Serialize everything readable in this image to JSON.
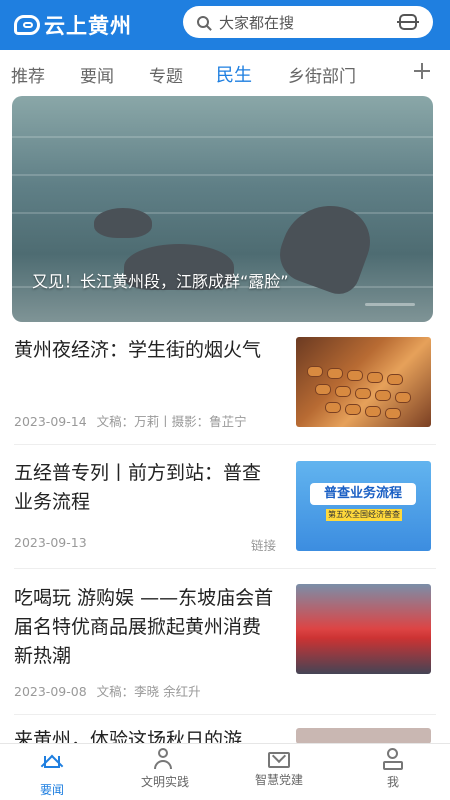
{
  "header": {
    "logo_text": "云上黄州",
    "search_placeholder": "大家都在搜"
  },
  "tabs": [
    {
      "label": "推荐",
      "active": false
    },
    {
      "label": "要闻",
      "active": false
    },
    {
      "label": "专题",
      "active": false
    },
    {
      "label": "民生",
      "active": true
    },
    {
      "label": "乡街部门",
      "active": false
    }
  ],
  "hero": {
    "caption": "又见！长江黄州段，江豚成群“露脸”"
  },
  "news": [
    {
      "title": "黄州夜经济：学生街的烟火气",
      "date": "2023-09-14",
      "byline": "文稿：万莉丨摄影：鲁芷宁",
      "tag": ""
    },
    {
      "title": "五经普专列丨前方到站：普查业务流程",
      "date": "2023-09-13",
      "byline": "",
      "tag": "链接",
      "thumb_banner": "普查业务流程",
      "thumb_sub": "第五次全国经济普查"
    },
    {
      "title": "吃喝玩 游购娱 ——东坡庙会首届名特优商品展掀起黄州消费新热潮",
      "date": "2023-09-08",
      "byline": "文稿：李晓 余红升",
      "tag": ""
    },
    {
      "title": "来黄州，体验这场秋日的游"
    }
  ],
  "bottom_nav": [
    {
      "label": "要闻",
      "icon": "home-icon",
      "active": true
    },
    {
      "label": "文明实践",
      "icon": "people-icon",
      "active": false
    },
    {
      "label": "智慧党建",
      "icon": "mail-icon",
      "active": false
    },
    {
      "label": "我",
      "icon": "user-icon",
      "active": false
    }
  ],
  "colors": {
    "brand": "#1f7fe0",
    "text": "#222222",
    "meta": "#999999"
  }
}
